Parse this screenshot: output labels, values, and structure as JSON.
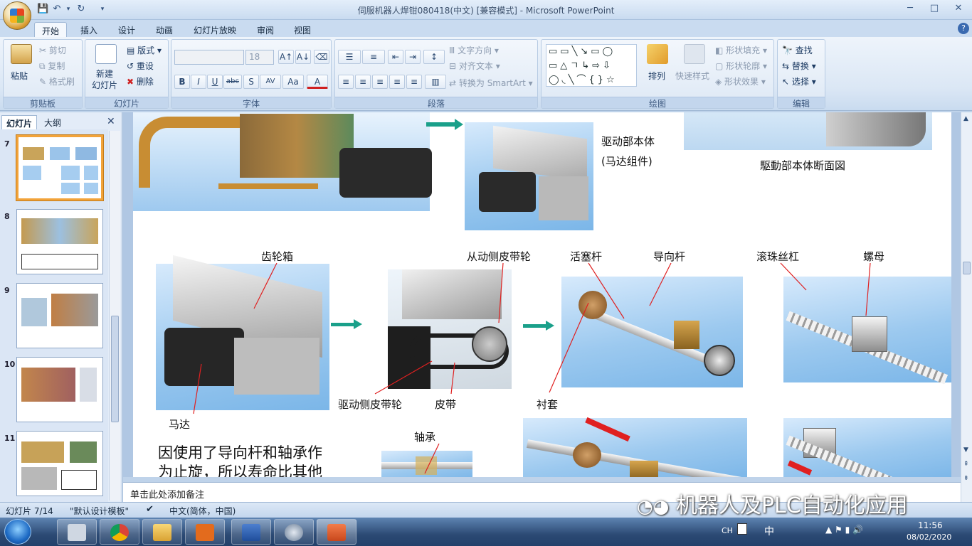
{
  "window": {
    "title": "伺服机器人焊钳080418(中文) [兼容模式] - Microsoft PowerPoint",
    "minimize": "─",
    "maximize": "□",
    "close": "✕"
  },
  "tabs": [
    "开始",
    "插入",
    "设计",
    "动画",
    "幻灯片放映",
    "审阅",
    "视图"
  ],
  "ribbon": {
    "clipboard": {
      "label": "剪贴板",
      "paste": "粘贴",
      "cut": "剪切",
      "copy": "复制",
      "format_painter": "格式刷"
    },
    "slides": {
      "label": "幻灯片",
      "new_slide": "新建\n幻灯片",
      "layout": "版式",
      "reset": "重设",
      "delete": "删除"
    },
    "font": {
      "label": "字体",
      "size": "18",
      "bold": "B",
      "italic": "I",
      "underline": "U",
      "strike": "abc",
      "shadow": "S",
      "spacing": "AV",
      "case": "Aa",
      "color": "A"
    },
    "paragraph": {
      "label": "段落",
      "text_direction": "文字方向",
      "align_text": "对齐文本",
      "convert_smartart": "转换为 SmartArt"
    },
    "drawing": {
      "label": "绘图",
      "arrange": "排列",
      "quick_styles": "快速样式",
      "shape_fill": "形状填充",
      "shape_outline": "形状轮廓",
      "shape_effects": "形状效果"
    },
    "editing": {
      "label": "编辑",
      "find": "查找",
      "replace": "替换",
      "select": "选择"
    }
  },
  "panel": {
    "tab_slides": "幻灯片",
    "tab_outline": "大纲",
    "close": "✕",
    "thumbnails": [
      {
        "num": "7",
        "selected": true
      },
      {
        "num": "8",
        "selected": false
      },
      {
        "num": "9",
        "selected": false
      },
      {
        "num": "10",
        "selected": false
      },
      {
        "num": "11",
        "selected": false
      }
    ]
  },
  "slide": {
    "captions": {
      "drive_body": "驱动部本体",
      "motor_assembly": "(马达组件)",
      "drive_section": "駆動部本体断面図",
      "gearbox": "齿轮箱",
      "driven_pulley": "从动侧皮带轮",
      "piston_rod": "活塞杆",
      "guide_rod": "导向杆",
      "ball_screw": "滚珠丝杠",
      "nut": "螺母",
      "motor": "马达",
      "drive_pulley": "驱动侧皮带轮",
      "belt": "皮带",
      "bushing": "衬套",
      "bearing": "轴承"
    },
    "body_lines": [
      "因使用了导向杆和轴承作",
      "为止旋，所以寿命比其他"
    ]
  },
  "notes_placeholder": "单击此处添加备注",
  "statusbar": {
    "slide_count": "幻灯片 7/14",
    "theme": "\"默认设计模板\"",
    "language": "中文(简体，中国)"
  },
  "taskbar": {
    "lang": "CH",
    "ime": "中",
    "time": "11:56",
    "date": "08/02/2020"
  },
  "watermark": "机器人及PLC自动化应用",
  "colors": {
    "accent_orange": "#f2a33a",
    "ribbon_blue": "#dbe7f5",
    "arrow_teal": "#1aa08a",
    "callout_red": "#e02020"
  }
}
